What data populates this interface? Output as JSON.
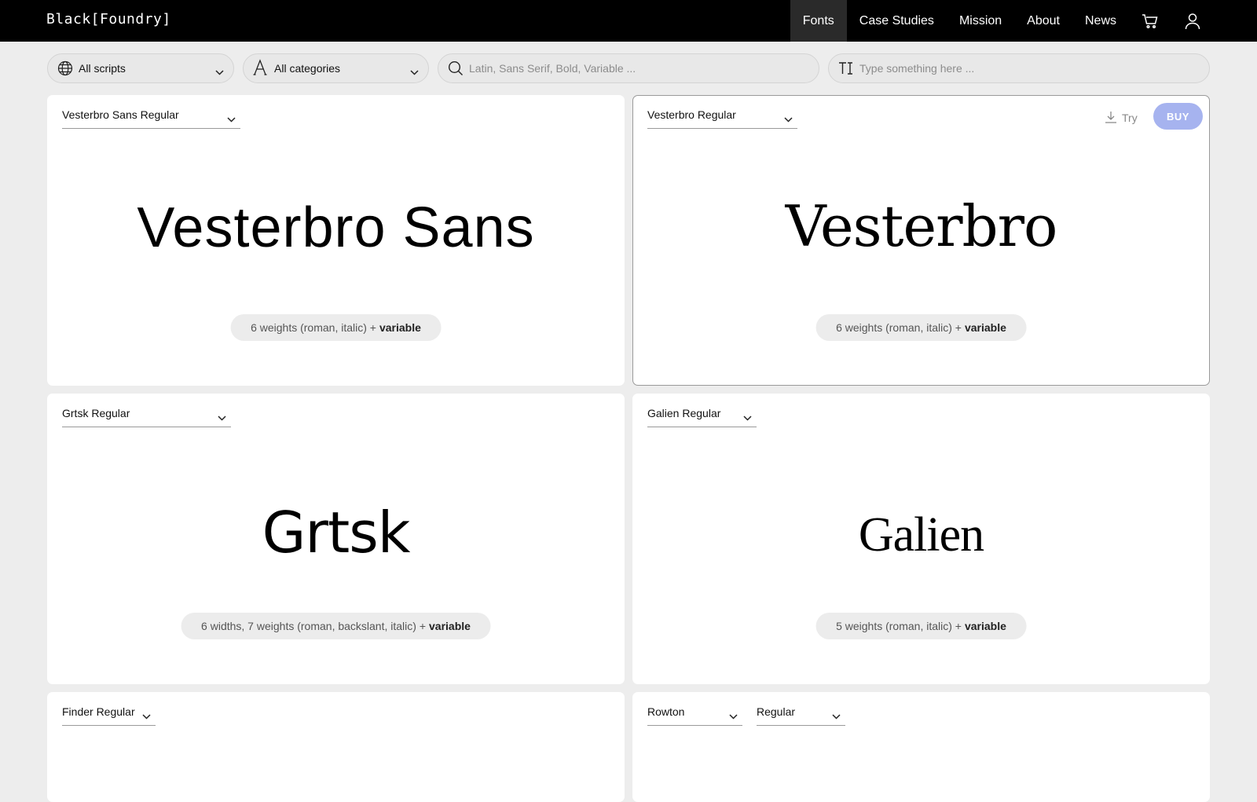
{
  "brand": {
    "logo": "Black[Foundry]"
  },
  "nav": {
    "items": [
      {
        "label": "Fonts",
        "active": true
      },
      {
        "label": "Case Studies"
      },
      {
        "label": "Mission"
      },
      {
        "label": "About"
      },
      {
        "label": "News"
      }
    ],
    "icons": [
      "cart-icon",
      "user-icon"
    ]
  },
  "filters": {
    "scripts": {
      "label": "All scripts",
      "icon": "globe-icon"
    },
    "categories": {
      "label": "All categories",
      "icon": "letter-a-icon"
    },
    "search": {
      "placeholder": "Latin, Sans Serif, Bold, Variable ...",
      "icon": "search-icon"
    },
    "type_tester": {
      "placeholder": "Type something here ...",
      "icon": "text-size-icon"
    }
  },
  "cards": [
    {
      "style": "Vesterbro Sans Regular",
      "specimen": "Vesterbro Sans",
      "info": "6 weights (roman, italic) +",
      "info_bold": "variable"
    },
    {
      "style": "Vesterbro Regular",
      "specimen": "Vesterbro",
      "info": "6 weights (roman, italic) +",
      "info_bold": "variable",
      "try_label": "Try",
      "buy_label": "BUY"
    },
    {
      "style": "Grtsk Regular",
      "specimen": "Grtsk",
      "info": "6 widths, 7 weights (roman, backslant, italic) +",
      "info_bold": "variable"
    },
    {
      "style": "Galien Regular",
      "specimen": "Galien",
      "info": "5 weights (roman, italic) +",
      "info_bold": "variable"
    },
    {
      "style": "Finder Regular"
    },
    {
      "family": "Rowton",
      "style": "Regular"
    }
  ],
  "colors": {
    "buy_button": "#a6b3ef",
    "topbar": "#000000",
    "active_nav": "#2a2a2a"
  }
}
